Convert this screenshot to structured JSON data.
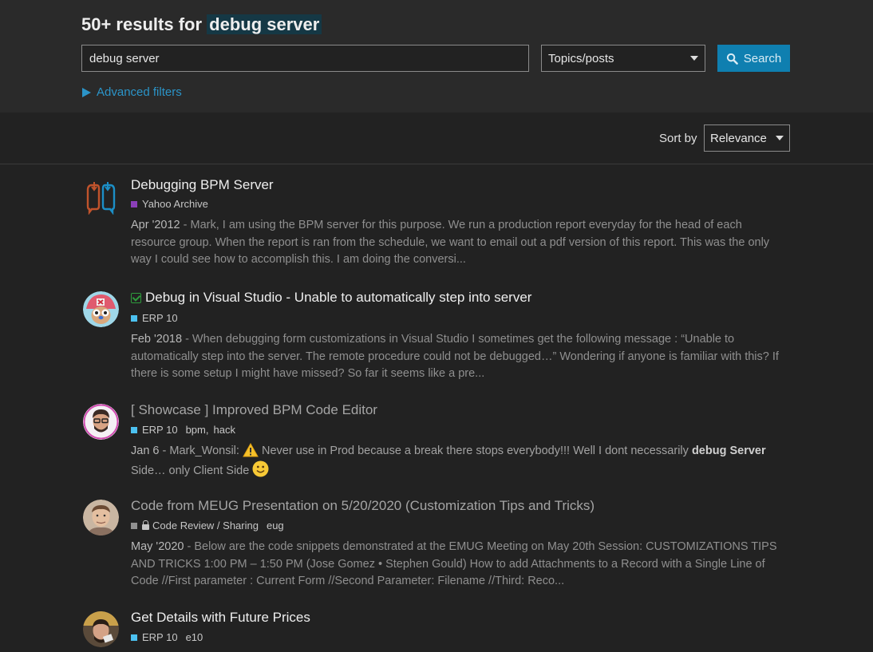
{
  "header": {
    "results_prefix": "50+ results for",
    "query": "debug server"
  },
  "search": {
    "value": "debug server",
    "type_selected": "Topics/posts",
    "button_label": "Search"
  },
  "filters": {
    "advanced_label": "Advanced filters"
  },
  "sort": {
    "label": "Sort by",
    "selected": "Relevance"
  },
  "results": [
    {
      "title": "Debugging BPM Server",
      "category": "Yahoo Archive",
      "category_color": "#8b3fb8",
      "tags": [],
      "date": "Apr '2012",
      "blurb": " - Mark, I am using the BPM server for this purpose. We run a production report everyday for the head of each resource group. When the report is ran from the schedule, we want to email out a pdf version of this report. This was the only way I could see how to accomplish this. I am doing the conversi..."
    },
    {
      "title": "Debug in Visual Studio - Unable to automatically step into server",
      "category": "ERP 10",
      "category_color": "#4cc1f0",
      "tags": [],
      "date": "Feb '2018",
      "blurb": " - When debugging form customizations in Visual Studio I sometimes get the following message : “Unable to automatically step into the server. The remote procedure could not be debugged…” Wondering if anyone is familiar with this? If there is some setup I might have missed? So far it seems like a pre..."
    },
    {
      "title": "[ Showcase ] Improved BPM Code Editor",
      "category": "ERP 10",
      "category_color": "#4cc1f0",
      "tags": [
        "bpm",
        "hack"
      ],
      "date": "Jan 6",
      "blurb_a": " - Mark_Wonsil: ",
      "blurb_b": " Never use in Prod because a break there stops everybody!!! Well I dont necessarily ",
      "hl1": "debug",
      "hl2": "Server",
      "blurb_c": " Side… only Client Side "
    },
    {
      "title": "Code from MEUG Presentation on 5/20/2020 (Customization Tips and Tricks)",
      "category": "Code Review / Sharing",
      "category_color": "#919191",
      "tags": [
        "eug"
      ],
      "date": "May '2020",
      "blurb": " - Below are the code snippets demonstrated at the EMUG Meeting on May 20th Session: CUSTOMIZATIONS TIPS AND TRICKS 1:00 PM – 1:50 PM (Jose Gomez • Stephen Gould) How to add Attachments to a Record with a Single Line of Code //First parameter : Current Form //Second Parameter: Filename //Third: Reco..."
    },
    {
      "title": "Get Details with Future Prices",
      "category": "ERP 10",
      "category_color": "#4cc1f0",
      "tags": [
        "e10"
      ],
      "date": "",
      "blurb": ""
    }
  ]
}
